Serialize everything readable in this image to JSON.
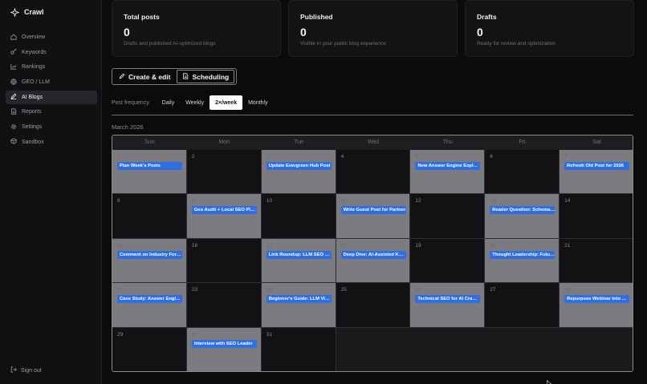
{
  "app": {
    "name": "Crawl"
  },
  "sidebar": {
    "items": [
      {
        "label": "Overview",
        "icon": "home-icon",
        "active": false
      },
      {
        "label": "Keywords",
        "icon": "key-icon",
        "active": false
      },
      {
        "label": "Rankings",
        "icon": "trend-icon",
        "active": false
      },
      {
        "label": "GEO / LLM",
        "icon": "globe-icon",
        "active": false
      },
      {
        "label": "AI Blogs",
        "icon": "pen-icon",
        "active": true
      },
      {
        "label": "Reports",
        "icon": "report-icon",
        "active": false
      },
      {
        "label": "Settings",
        "icon": "gear-icon",
        "active": false
      },
      {
        "label": "Sandbox",
        "icon": "box-icon",
        "active": false
      }
    ],
    "signout": "Sign out"
  },
  "stats": [
    {
      "title": "Total posts",
      "value": "0",
      "sub": "Drafts and published AI-optimized blogs"
    },
    {
      "title": "Published",
      "value": "0",
      "sub": "Visible in your public blog experience"
    },
    {
      "title": "Drafts",
      "value": "0",
      "sub": "Ready for review and optimization"
    }
  ],
  "mode": {
    "create": "Create & edit",
    "scheduling": "Scheduling"
  },
  "frequency": {
    "label": "Post frequency:",
    "options": [
      "Daily",
      "Weekly",
      "2×/week",
      "Monthly"
    ],
    "selected": "2×/week"
  },
  "calendar": {
    "month": "March 2026",
    "weekdays": [
      "Sun",
      "Mon",
      "Tue",
      "Wed",
      "Thu",
      "Fri",
      "Sat"
    ],
    "days": [
      {
        "day": "1",
        "event": "Plan Week's Posts"
      },
      {
        "day": "2",
        "event": ""
      },
      {
        "day": "3",
        "event": "Update Evergreen Hub Post"
      },
      {
        "day": "4",
        "event": ""
      },
      {
        "day": "5",
        "event": "New Answer Engine Explai..."
      },
      {
        "day": "6",
        "event": ""
      },
      {
        "day": "7",
        "event": "Refresh Old Post for 2026"
      },
      {
        "day": "8",
        "event": ""
      },
      {
        "day": "9",
        "event": "Geo Audit + Local SEO Play..."
      },
      {
        "day": "10",
        "event": ""
      },
      {
        "day": "11",
        "event": "Write Guest Post for Partner"
      },
      {
        "day": "12",
        "event": ""
      },
      {
        "day": "13",
        "event": "Reader Question: Schema f..."
      },
      {
        "day": "14",
        "event": ""
      },
      {
        "day": "15",
        "event": "Comment on Industry Foru..."
      },
      {
        "day": "16",
        "event": ""
      },
      {
        "day": "17",
        "event": "Link Roundup: LLM SEO Re..."
      },
      {
        "day": "18",
        "event": "Deep Dive: AI-Assisted Key..."
      },
      {
        "day": "19",
        "event": ""
      },
      {
        "day": "20",
        "event": "Thought Leadership: Futur..."
      },
      {
        "day": "21",
        "event": ""
      },
      {
        "day": "22",
        "event": "Case Study: Answer Engin..."
      },
      {
        "day": "23",
        "event": ""
      },
      {
        "day": "24",
        "event": "Beginner's Guide: LLM Visi..."
      },
      {
        "day": "25",
        "event": ""
      },
      {
        "day": "26",
        "event": "Technical SEO for AI Crawl..."
      },
      {
        "day": "27",
        "event": ""
      },
      {
        "day": "28",
        "event": "Repurpose Webinar into Blog"
      },
      {
        "day": "29",
        "event": ""
      },
      {
        "day": "30",
        "event": "Interview with SEO Leader"
      },
      {
        "day": "31",
        "event": ""
      }
    ]
  }
}
